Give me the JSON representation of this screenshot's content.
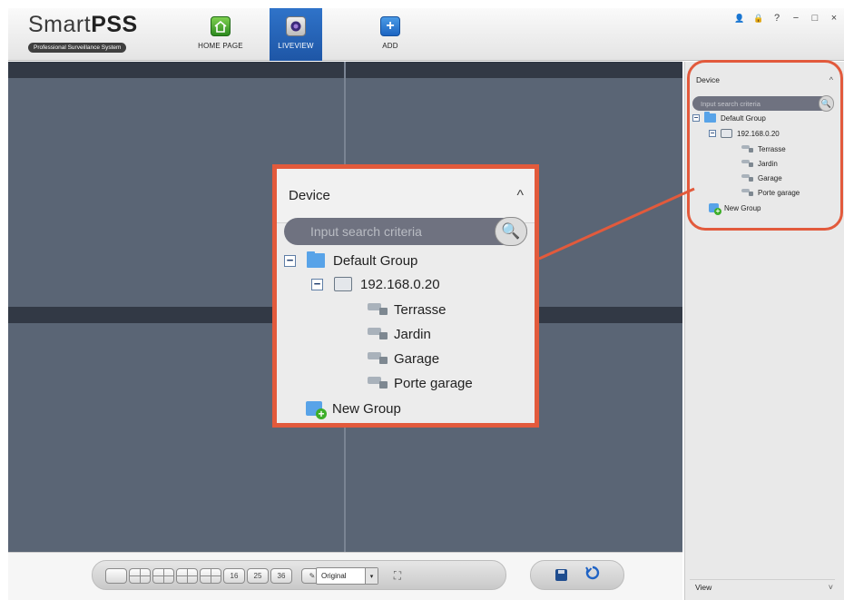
{
  "app": {
    "logo_main_prefix": "Smart",
    "logo_main_bold": "PSS",
    "logo_sub": "Professional Surveillance System"
  },
  "nav": {
    "home_label": "HOME PAGE",
    "liveview_label": "LIVEVIEW",
    "add_label": "ADD",
    "add_icon": "+"
  },
  "window_controls": {
    "user": "👤",
    "lock": "🔒",
    "help": "?",
    "minimize": "−",
    "maximize": "□",
    "close": "×"
  },
  "device_panel": {
    "title": "Device",
    "collapse_icon": "^",
    "search_placeholder": "Input search criteria",
    "search_icon": "🔍",
    "group_expander": "−",
    "group_name": "Default Group",
    "device_expander": "−",
    "device_ip": "192.168.0.20",
    "cameras": [
      "Terrasse",
      "Jardin",
      "Garage",
      "Porte garage"
    ],
    "new_group": "New Group",
    "view_title": "View",
    "expand_icon": "˅"
  },
  "toolbar": {
    "layout_labels": [
      "",
      "",
      "",
      "",
      "",
      "16",
      "25",
      "36"
    ],
    "draw_icon": "✎",
    "stream_select": "Original",
    "dropdown_arrow": "▾",
    "fullscreen_icon": "⛶"
  },
  "colors": {
    "highlight": "#e25a3c",
    "video_bg": "#5a6575",
    "active_tab": "#2f73c9"
  }
}
